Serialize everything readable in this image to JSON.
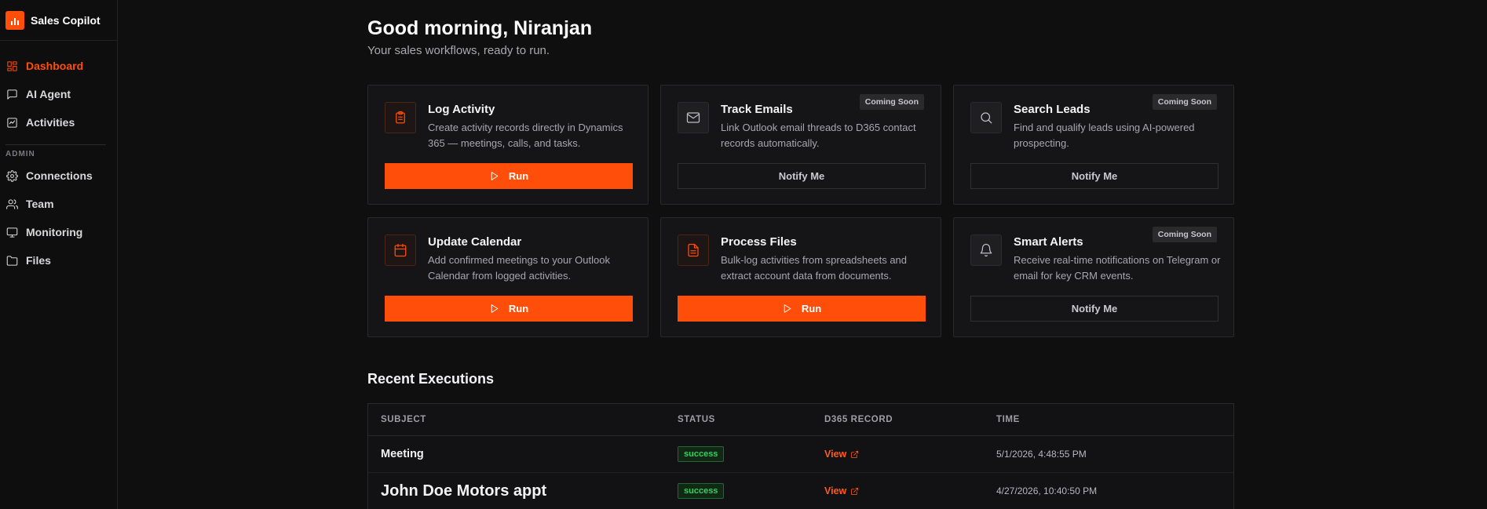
{
  "app": {
    "name": "Sales Copilot",
    "accent": "#ff4d0a"
  },
  "sidebar": {
    "items": [
      {
        "label": "Dashboard",
        "icon": "dashboard-icon",
        "active": true
      },
      {
        "label": "AI Agent",
        "icon": "chat-icon"
      },
      {
        "label": "Activities",
        "icon": "activity-icon"
      }
    ],
    "admin_section": "ADMIN",
    "admin_items": [
      {
        "label": "Connections",
        "icon": "gear-icon"
      },
      {
        "label": "Team",
        "icon": "users-icon"
      },
      {
        "label": "Monitoring",
        "icon": "monitor-icon"
      },
      {
        "label": "Files",
        "icon": "folder-icon"
      }
    ]
  },
  "header": {
    "greeting": "Good morning, Niranjan",
    "subtitle": "Your sales workflows, ready to run."
  },
  "cards": [
    {
      "title": "Log Activity",
      "desc": "Create activity records directly in Dynamics 365 — meetings, calls, and tasks.",
      "action": "Run",
      "icon": "clipboard-icon"
    },
    {
      "title": "Track Emails",
      "desc": "Link Outlook email threads to D365 contact records automatically.",
      "action": "Notify Me",
      "badge": "Coming Soon",
      "icon": "mail-icon"
    },
    {
      "title": "Search Leads",
      "desc": "Find and qualify leads using AI-powered prospecting.",
      "action": "Notify Me",
      "badge": "Coming Soon",
      "icon": "search-icon"
    },
    {
      "title": "Update Calendar",
      "desc": "Add confirmed meetings to your Outlook Calendar from logged activities.",
      "action": "Run",
      "icon": "calendar-icon"
    },
    {
      "title": "Process Files",
      "desc": "Bulk-log activities from spreadsheets and extract account data from documents.",
      "action": "Run",
      "icon": "file-icon"
    },
    {
      "title": "Smart Alerts",
      "desc": "Receive real-time notifications on Telegram or email for key CRM events.",
      "action": "Notify Me",
      "badge": "Coming Soon",
      "icon": "bell-icon"
    }
  ],
  "recent": {
    "title": "Recent Executions",
    "columns": [
      "SUBJECT",
      "STATUS",
      "D365 RECORD",
      "TIME"
    ],
    "rows": [
      {
        "subject": "Meeting",
        "status": "success",
        "record": "View",
        "time": "5/1/2026, 4:48:55 PM"
      },
      {
        "subject": "John Doe Motors appt",
        "status": "success",
        "record": "View",
        "time": "4/27/2026, 10:40:50 PM"
      }
    ]
  }
}
